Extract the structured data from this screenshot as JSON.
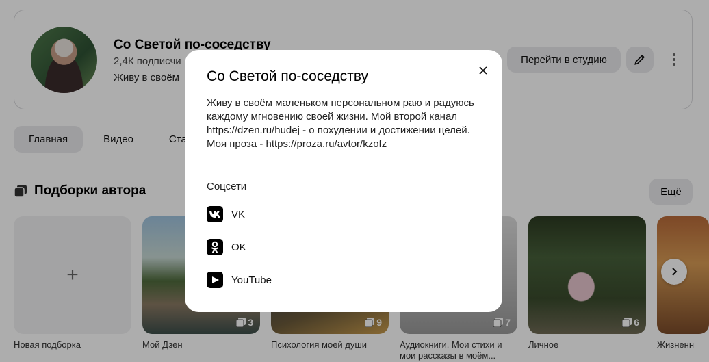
{
  "channel": {
    "title": "Со Светой по-соседству",
    "subscribers": "2,4К подписчи",
    "description_short": "Живу в своём",
    "studio_button": "Перейти в студию"
  },
  "tabs": [
    {
      "label": "Главная",
      "active": true
    },
    {
      "label": "Видео",
      "active": false
    },
    {
      "label": "Стат",
      "active": false
    }
  ],
  "collections": {
    "title": "Подборки автора",
    "more_label": "Ещё",
    "items": [
      {
        "label": "Новая подборка",
        "count": ""
      },
      {
        "label": "Мой Дзен",
        "count": "3"
      },
      {
        "label": "Психология моей души",
        "count": "9"
      },
      {
        "label": "Аудиокниги. Мои стихи и мои рассказы в моём...",
        "count": "7"
      },
      {
        "label": "Личное",
        "count": "6"
      },
      {
        "label": "Жизненн",
        "count": ""
      }
    ]
  },
  "modal": {
    "title": "Со Светой по-соседству",
    "description": "Живу в своём маленьком персональном раю и радуюсь каждому мгновению своей жизни. Мой второй канал https://dzen.ru/hudej - о похудении и достижении целей. Моя проза - https://proza.ru/avtor/kzofz",
    "social_title": "Соцсети",
    "socials": [
      {
        "label": "VK",
        "icon": "vk-icon"
      },
      {
        "label": "OK",
        "icon": "ok-icon"
      },
      {
        "label": "YouTube",
        "icon": "youtube-icon"
      }
    ]
  },
  "colors": {
    "overlay": "rgba(0,0,0,0.32)",
    "button_bg": "#e9e9ec"
  }
}
